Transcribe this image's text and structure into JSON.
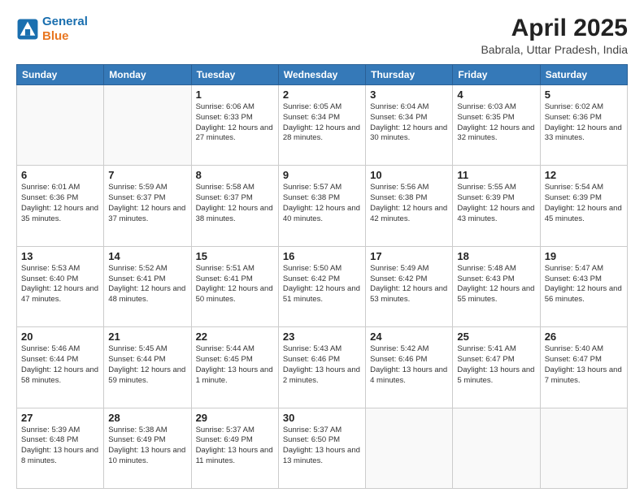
{
  "header": {
    "logo_line1": "General",
    "logo_line2": "Blue",
    "title": "April 2025",
    "subtitle": "Babrala, Uttar Pradesh, India"
  },
  "weekdays": [
    "Sunday",
    "Monday",
    "Tuesday",
    "Wednesday",
    "Thursday",
    "Friday",
    "Saturday"
  ],
  "weeks": [
    [
      {
        "day": "",
        "info": ""
      },
      {
        "day": "",
        "info": ""
      },
      {
        "day": "1",
        "info": "Sunrise: 6:06 AM\nSunset: 6:33 PM\nDaylight: 12 hours and 27 minutes."
      },
      {
        "day": "2",
        "info": "Sunrise: 6:05 AM\nSunset: 6:34 PM\nDaylight: 12 hours and 28 minutes."
      },
      {
        "day": "3",
        "info": "Sunrise: 6:04 AM\nSunset: 6:34 PM\nDaylight: 12 hours and 30 minutes."
      },
      {
        "day": "4",
        "info": "Sunrise: 6:03 AM\nSunset: 6:35 PM\nDaylight: 12 hours and 32 minutes."
      },
      {
        "day": "5",
        "info": "Sunrise: 6:02 AM\nSunset: 6:36 PM\nDaylight: 12 hours and 33 minutes."
      }
    ],
    [
      {
        "day": "6",
        "info": "Sunrise: 6:01 AM\nSunset: 6:36 PM\nDaylight: 12 hours and 35 minutes."
      },
      {
        "day": "7",
        "info": "Sunrise: 5:59 AM\nSunset: 6:37 PM\nDaylight: 12 hours and 37 minutes."
      },
      {
        "day": "8",
        "info": "Sunrise: 5:58 AM\nSunset: 6:37 PM\nDaylight: 12 hours and 38 minutes."
      },
      {
        "day": "9",
        "info": "Sunrise: 5:57 AM\nSunset: 6:38 PM\nDaylight: 12 hours and 40 minutes."
      },
      {
        "day": "10",
        "info": "Sunrise: 5:56 AM\nSunset: 6:38 PM\nDaylight: 12 hours and 42 minutes."
      },
      {
        "day": "11",
        "info": "Sunrise: 5:55 AM\nSunset: 6:39 PM\nDaylight: 12 hours and 43 minutes."
      },
      {
        "day": "12",
        "info": "Sunrise: 5:54 AM\nSunset: 6:39 PM\nDaylight: 12 hours and 45 minutes."
      }
    ],
    [
      {
        "day": "13",
        "info": "Sunrise: 5:53 AM\nSunset: 6:40 PM\nDaylight: 12 hours and 47 minutes."
      },
      {
        "day": "14",
        "info": "Sunrise: 5:52 AM\nSunset: 6:41 PM\nDaylight: 12 hours and 48 minutes."
      },
      {
        "day": "15",
        "info": "Sunrise: 5:51 AM\nSunset: 6:41 PM\nDaylight: 12 hours and 50 minutes."
      },
      {
        "day": "16",
        "info": "Sunrise: 5:50 AM\nSunset: 6:42 PM\nDaylight: 12 hours and 51 minutes."
      },
      {
        "day": "17",
        "info": "Sunrise: 5:49 AM\nSunset: 6:42 PM\nDaylight: 12 hours and 53 minutes."
      },
      {
        "day": "18",
        "info": "Sunrise: 5:48 AM\nSunset: 6:43 PM\nDaylight: 12 hours and 55 minutes."
      },
      {
        "day": "19",
        "info": "Sunrise: 5:47 AM\nSunset: 6:43 PM\nDaylight: 12 hours and 56 minutes."
      }
    ],
    [
      {
        "day": "20",
        "info": "Sunrise: 5:46 AM\nSunset: 6:44 PM\nDaylight: 12 hours and 58 minutes."
      },
      {
        "day": "21",
        "info": "Sunrise: 5:45 AM\nSunset: 6:44 PM\nDaylight: 12 hours and 59 minutes."
      },
      {
        "day": "22",
        "info": "Sunrise: 5:44 AM\nSunset: 6:45 PM\nDaylight: 13 hours and 1 minute."
      },
      {
        "day": "23",
        "info": "Sunrise: 5:43 AM\nSunset: 6:46 PM\nDaylight: 13 hours and 2 minutes."
      },
      {
        "day": "24",
        "info": "Sunrise: 5:42 AM\nSunset: 6:46 PM\nDaylight: 13 hours and 4 minutes."
      },
      {
        "day": "25",
        "info": "Sunrise: 5:41 AM\nSunset: 6:47 PM\nDaylight: 13 hours and 5 minutes."
      },
      {
        "day": "26",
        "info": "Sunrise: 5:40 AM\nSunset: 6:47 PM\nDaylight: 13 hours and 7 minutes."
      }
    ],
    [
      {
        "day": "27",
        "info": "Sunrise: 5:39 AM\nSunset: 6:48 PM\nDaylight: 13 hours and 8 minutes."
      },
      {
        "day": "28",
        "info": "Sunrise: 5:38 AM\nSunset: 6:49 PM\nDaylight: 13 hours and 10 minutes."
      },
      {
        "day": "29",
        "info": "Sunrise: 5:37 AM\nSunset: 6:49 PM\nDaylight: 13 hours and 11 minutes."
      },
      {
        "day": "30",
        "info": "Sunrise: 5:37 AM\nSunset: 6:50 PM\nDaylight: 13 hours and 13 minutes."
      },
      {
        "day": "",
        "info": ""
      },
      {
        "day": "",
        "info": ""
      },
      {
        "day": "",
        "info": ""
      }
    ]
  ]
}
